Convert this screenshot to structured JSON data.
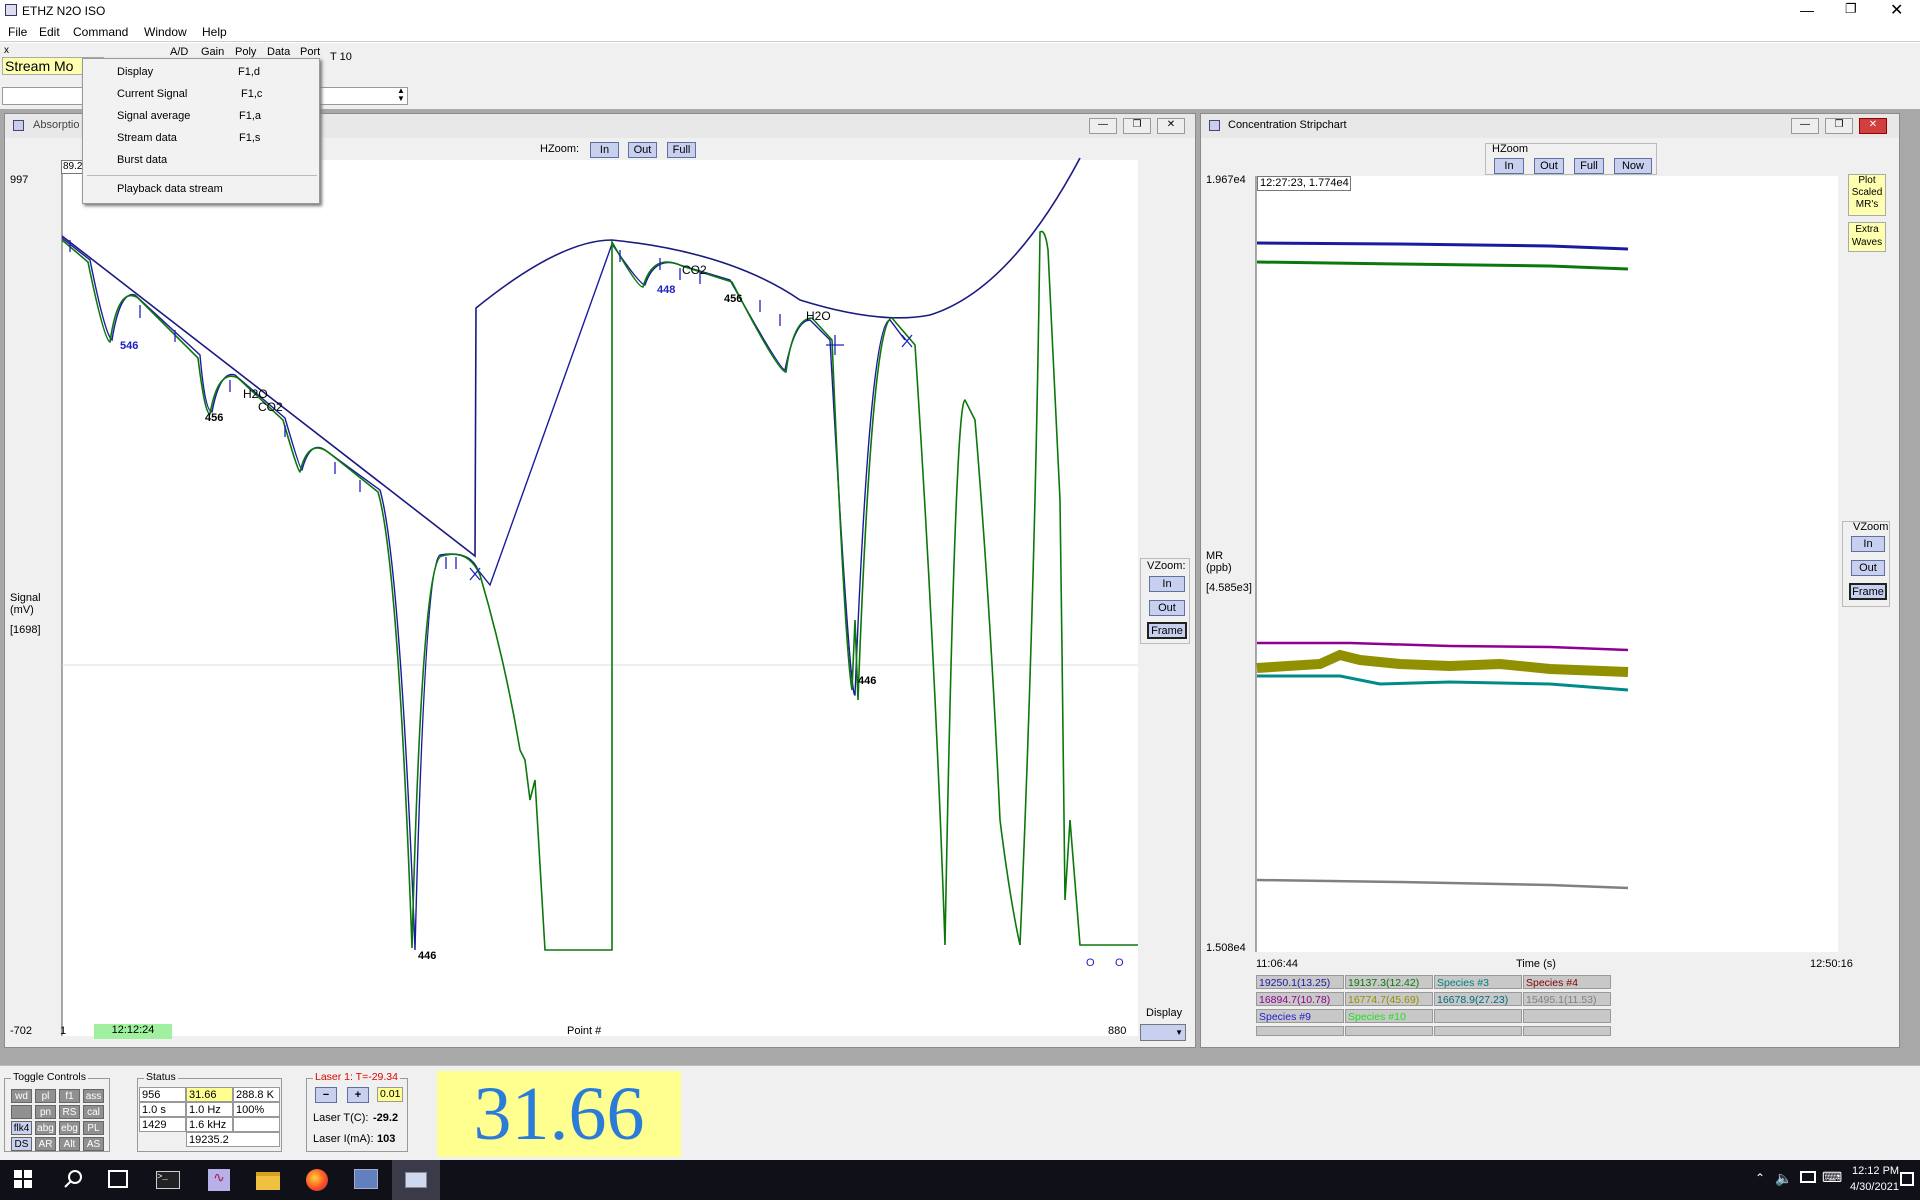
{
  "app": {
    "title": "ETHZ N2O ISO"
  },
  "menu": [
    "File",
    "Edit",
    "Command",
    "Window",
    "Help"
  ],
  "toolbar": {
    "mode": "Stream Mo",
    "items": [
      "A/D",
      "Gain",
      "Poly",
      "Data",
      "Port"
    ],
    "t_label": "T 10",
    "box_x": "x"
  },
  "dropdown": {
    "items": [
      {
        "label": "Display",
        "key": "F1,d"
      },
      {
        "label": "Current Signal",
        "key": "F1,c"
      },
      {
        "label": "Signal average",
        "key": "F1,a"
      },
      {
        "label": "Stream data",
        "key": "F1,s"
      },
      {
        "label": "Burst data",
        "key": ""
      }
    ],
    "playback": "Playback data stream"
  },
  "absorption": {
    "title": "Absorptio",
    "hzoom": {
      "label": "HZoom:",
      "in": "In",
      "out": "Out",
      "full": "Full"
    },
    "y_top": "997",
    "y_bottom": "-702",
    "box_value": "89.2",
    "ylabel": [
      "Signal",
      "(mV)",
      "[1698]"
    ],
    "x_start": "1",
    "x_end": "880",
    "time": "12:12:24",
    "xlabel": "Point #",
    "vzoom": {
      "label": "VZoom:",
      "in": "In",
      "out": "Out",
      "frame": "Frame"
    },
    "display_label": "Display",
    "annotations": {
      "p546": "546",
      "p456a": "456",
      "h2o_a": "H2O",
      "co2_a": "CO2",
      "p446a": "446",
      "p448": "448",
      "co2_b": "CO2",
      "p456b": "456",
      "h2o_b": "H2O",
      "p446b": "446",
      "o1": "O",
      "o2": "O"
    }
  },
  "stripchart": {
    "title": "Concentration Stripchart",
    "hzoom": {
      "label": "HZoom",
      "in": "In",
      "out": "Out",
      "full": "Full",
      "now": "Now"
    },
    "y_top": "1.967e4",
    "y_bottom": "1.508e4",
    "ylabel": [
      "MR",
      "(ppb)",
      "[4.585e3]"
    ],
    "readout": "12:27:23,  1.774e4",
    "x_start": "11:06:44",
    "x_end": "12:50:16",
    "xlabel": "Time (s)",
    "side": {
      "plot_scaled": [
        "Plot",
        "Scaled",
        "MR's"
      ],
      "extra_waves": [
        "Extra",
        "Waves"
      ]
    },
    "vzoom": {
      "label": "VZoom",
      "in": "In",
      "out": "Out",
      "frame": "Frame"
    },
    "legend": [
      [
        {
          "t": "19250.1(13.25)",
          "c": "#1a1aa0"
        },
        {
          "t": "19137.3(12.42)",
          "c": "#0c780c"
        },
        {
          "t": "Species #3",
          "c": "#008080"
        },
        {
          "t": "Species #4",
          "c": "#800000"
        }
      ],
      [
        {
          "t": "16894.7(10.78)",
          "c": "#900090"
        },
        {
          "t": "16774.7(45.69)",
          "c": "#909000"
        },
        {
          "t": "16678.9(27.23)",
          "c": "#006a80"
        },
        {
          "t": "15495.1(11.53)",
          "c": "#808080"
        }
      ],
      [
        {
          "t": "Species #9",
          "c": "#2020d0"
        },
        {
          "t": "Species #10",
          "c": "#20e020"
        },
        {
          "t": "",
          "c": "#000"
        },
        {
          "t": "",
          "c": "#000"
        }
      ],
      [
        {
          "t": "",
          "c": "#000"
        },
        {
          "t": "",
          "c": "#000"
        },
        {
          "t": "",
          "c": "#000"
        },
        {
          "t": "",
          "c": "#000"
        }
      ]
    ]
  },
  "toggle": {
    "title": "Toggle Controls",
    "buttons": [
      "wd",
      "pl",
      "f1",
      "ass",
      "",
      "pn",
      "RS",
      "cal",
      "flk4",
      "abg",
      "ebg",
      "PL",
      "DS",
      "AR",
      "Alt",
      "AS"
    ]
  },
  "status": {
    "title": "Status",
    "cells": [
      "956",
      "31.66",
      "288.8 K",
      "1.0 s",
      "1.0 Hz",
      "100%",
      "1429",
      "1.6 kHz",
      "",
      "",
      "19235.2",
      ""
    ]
  },
  "laser": {
    "title": "Laser  1: T=-29.34",
    "minus": "−",
    "plus": "+",
    "step": "0.01",
    "temp_label": "Laser T(C):",
    "temp": "-29.2",
    "current_label": "Laser I(mA):",
    "current": "103"
  },
  "big_value": "31.66",
  "taskbar": {
    "time": "12:12 PM",
    "date": "4/30/2021"
  }
}
